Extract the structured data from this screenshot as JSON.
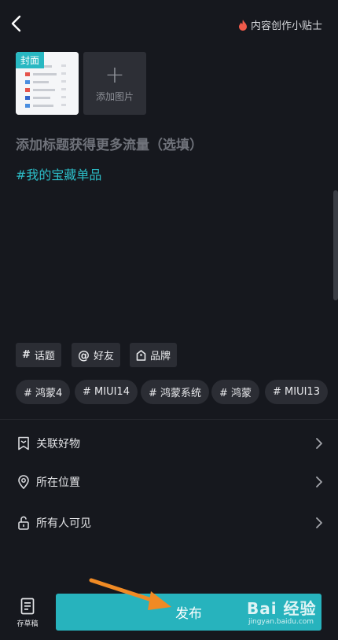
{
  "header": {
    "tips_label": "内容创作小贴士"
  },
  "media": {
    "cover_tag": "封面",
    "add_image_label": "添加图片"
  },
  "editor": {
    "title_placeholder": "添加标题获得更多流量（选填）",
    "hashtag": "#我的宝藏单品"
  },
  "tools": [
    {
      "symbol": "#",
      "label": "话题"
    },
    {
      "symbol": "@",
      "label": "好友"
    },
    {
      "symbol": "",
      "label": "品牌"
    }
  ],
  "suggestions": [
    "# 鸿蒙4",
    "# MIUI14",
    "# 鸿蒙系统",
    "# 鸿蒙",
    "# MIUI13"
  ],
  "settings": [
    {
      "label": "关联好物",
      "icon": "bookmark-icon"
    },
    {
      "label": "所在位置",
      "icon": "location-pin-icon"
    },
    {
      "label": "所有人可见",
      "icon": "unlock-icon"
    }
  ],
  "bottom": {
    "draft_label": "存草稿",
    "publish_label": "发布"
  },
  "watermark": {
    "main": "Bai 经验",
    "sub": "jingyan.baidu.com"
  },
  "colors": {
    "accent": "#27b3bd",
    "background": "#16181e",
    "tips_icon": "#f05a4a"
  }
}
